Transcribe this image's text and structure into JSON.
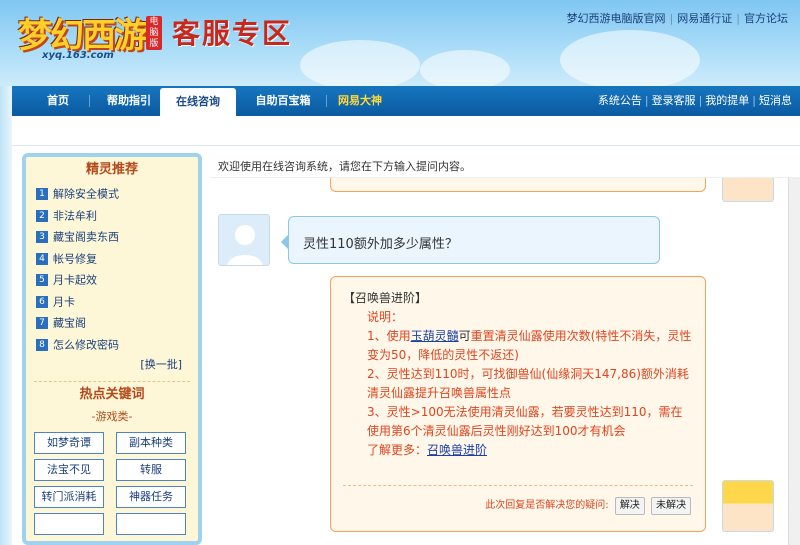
{
  "header": {
    "brand": "梦幻西游",
    "edition_badge": "电脑版",
    "domain": "xyq.163.com",
    "page_title": "客服专区",
    "top_links": [
      "梦幻西游电脑版官网",
      "网易通行证",
      "官方论坛"
    ]
  },
  "nav": {
    "tabs": [
      {
        "label": "首页"
      },
      {
        "label": "帮助指引"
      },
      {
        "label": "在线咨询"
      },
      {
        "label": "自助百宝箱"
      },
      {
        "label": "网易大神"
      }
    ],
    "right_links": [
      "系统公告",
      "登录客服",
      "我的提单",
      "短消息"
    ]
  },
  "sidebar": {
    "title": "精灵推荐",
    "tips": [
      {
        "num": "1",
        "label": "解除安全模式"
      },
      {
        "num": "2",
        "label": "非法牟利"
      },
      {
        "num": "3",
        "label": "藏宝阁卖东西"
      },
      {
        "num": "4",
        "label": "帐号修复"
      },
      {
        "num": "5",
        "label": "月卡起效"
      },
      {
        "num": "6",
        "label": "月卡"
      },
      {
        "num": "7",
        "label": "藏宝阁"
      },
      {
        "num": "8",
        "label": "怎么修改密码"
      }
    ],
    "swap_label": "[换一批]",
    "hot_title": "热点关键词",
    "game_category": "-游戏类-",
    "keywords": [
      "如梦奇谭",
      "副本种类",
      "法宝不见",
      "转服",
      "转门派消耗",
      "神器任务",
      "",
      ""
    ]
  },
  "main": {
    "welcome": "欢迎使用在线咨询系统，请您在下方输入提问内容。",
    "user_message": "灵性110额外加多少属性？",
    "bot": {
      "heading": "【召唤兽进阶】",
      "note": "说明：",
      "line1_a": "1、使用",
      "line1_link": "玉葫灵髓",
      "line1_b": "可",
      "line1_c": "重置清灵仙露使用次数(特性不消失，灵性变为50，降低的灵性不返还)",
      "line2": "2、灵性达到110时，可找御兽仙(仙缘洞天147,86)额外消耗清灵仙露提升召唤兽属性点",
      "line3": "3、灵性>100无法使用清灵仙露，若要灵性达到110，需在使用第6个清灵仙露后灵性刚好达到100才有机会",
      "more_label": "了解更多：",
      "more_link": "召唤兽进阶",
      "resolve_question": "此次回复是否解决您的疑问:",
      "resolved_button": "解决",
      "unresolved_button": "未解决"
    }
  }
}
